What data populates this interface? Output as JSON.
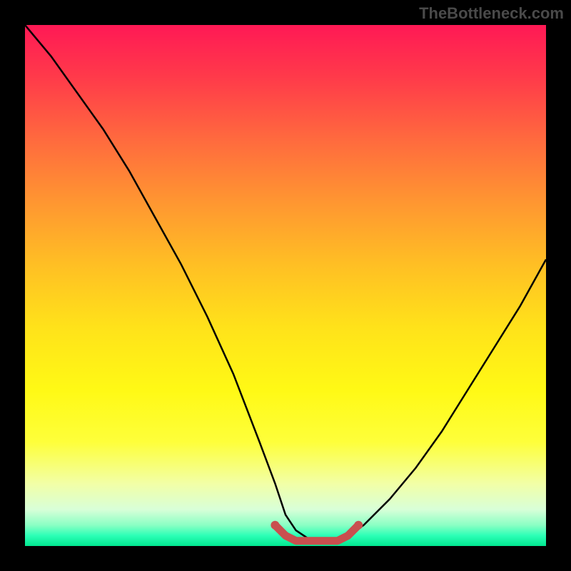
{
  "watermark": "TheBottleneck.com",
  "chart_data": {
    "type": "line",
    "title": "",
    "xlabel": "",
    "ylabel": "",
    "xlim": [
      0,
      100
    ],
    "ylim": [
      0,
      100
    ],
    "grid": false,
    "series": [
      {
        "name": "curve",
        "color": "#000000",
        "x": [
          0,
          5,
          10,
          15,
          20,
          25,
          30,
          35,
          40,
          45,
          48,
          50,
          52,
          55,
          58,
          60,
          62,
          65,
          70,
          75,
          80,
          85,
          90,
          95,
          100
        ],
        "values": [
          100,
          94,
          87,
          80,
          72,
          63,
          54,
          44,
          33,
          20,
          12,
          6,
          3,
          1,
          1,
          1,
          2,
          4,
          9,
          15,
          22,
          30,
          38,
          46,
          55
        ]
      },
      {
        "name": "highlight",
        "color": "#d9534f",
        "x": [
          48,
          50,
          52,
          55,
          58,
          60,
          62,
          64
        ],
        "values": [
          4,
          2,
          1,
          1,
          1,
          1,
          2,
          4
        ]
      }
    ]
  }
}
